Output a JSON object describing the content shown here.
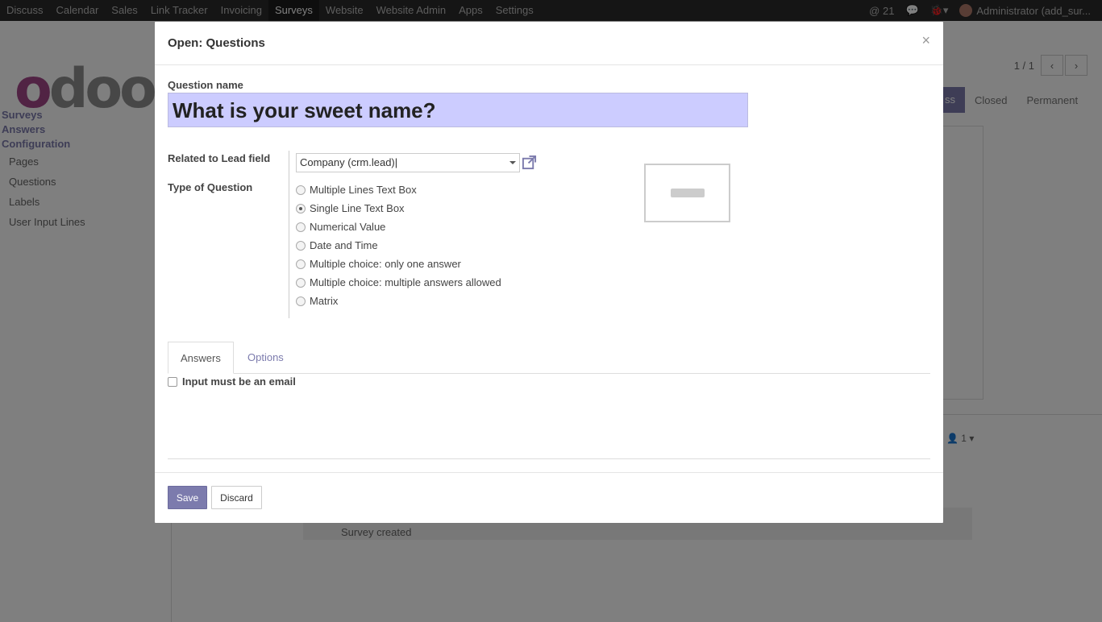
{
  "navbar": {
    "menu": [
      "Discuss",
      "Calendar",
      "Sales",
      "Link Tracker",
      "Invoicing",
      "Surveys",
      "Website",
      "Website Admin",
      "Apps",
      "Settings"
    ],
    "active_menu": "Surveys",
    "notification_count": "21",
    "user": "Administrator (add_sur..."
  },
  "background": {
    "sidebar_sections": [
      "Surveys",
      "Answers",
      "Configuration"
    ],
    "sidebar_items": [
      "Pages",
      "Questions",
      "Labels",
      "User Input Lines"
    ],
    "pager": "1 / 1",
    "status_stages": [
      "ss",
      "Closed",
      "Permanent"
    ],
    "followers": "1",
    "chatter_message": "Survey created"
  },
  "modal": {
    "title": "Open: Questions",
    "question_name_label": "Question name",
    "question_name_value": "What is your sweet name?",
    "related_label": "Related to Lead field",
    "related_value": "Company (crm.lead)",
    "type_label": "Type of Question",
    "question_types": [
      "Multiple Lines Text Box",
      "Single Line Text Box",
      "Numerical Value",
      "Date and Time",
      "Multiple choice: only one answer",
      "Multiple choice: multiple answers allowed",
      "Matrix"
    ],
    "selected_type": "Single Line Text Box",
    "tabs": [
      "Answers",
      "Options"
    ],
    "active_tab": "Answers",
    "email_check_label": "Input must be an email",
    "save_label": "Save",
    "discard_label": "Discard"
  },
  "colors": {
    "accent": "#7c7bad",
    "brand": "#a24689",
    "input_highlight": "#ccccff"
  }
}
